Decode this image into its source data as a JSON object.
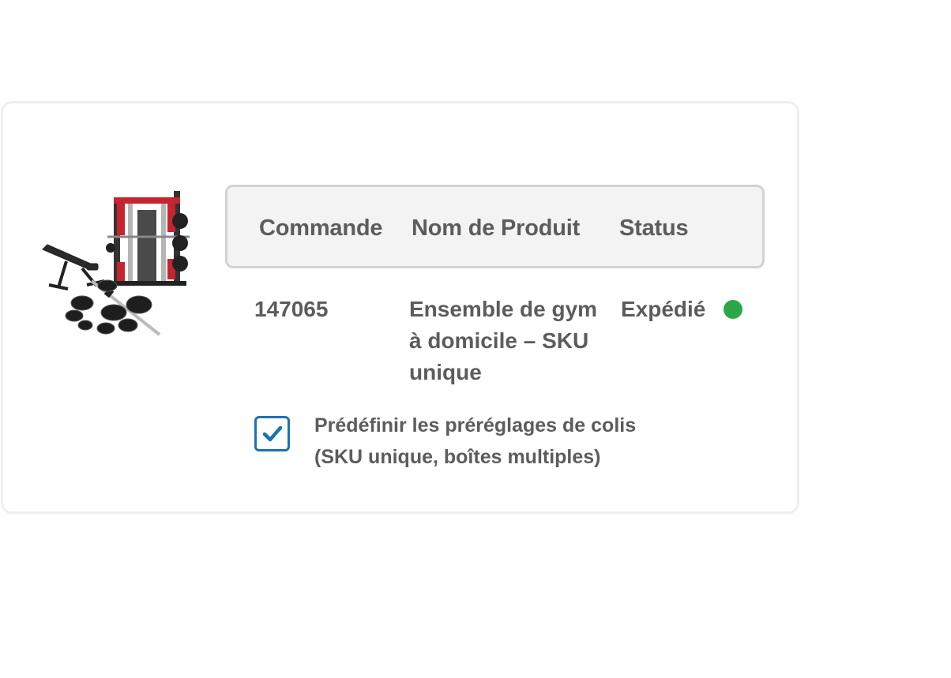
{
  "table": {
    "headers": {
      "order": "Commande",
      "product_name": "Nom de Produit",
      "status": "Status"
    },
    "rows": [
      {
        "order": "147065",
        "product_name": "Ensemble de gym à domicile – SKU unique",
        "status": "Expédié",
        "status_color": "#2aa847"
      }
    ]
  },
  "preset_option": {
    "checked": true,
    "label_line1": "Prédéfinir les préréglages de colis",
    "label_line2": "(SKU unique, boîtes multiples)"
  },
  "colors": {
    "accent": "#1d72b0",
    "header_bg": "#f3f3f3",
    "text": "#5c5c5c",
    "gym_red": "#c8242f"
  },
  "icons": {
    "product": "home-gym-equipment-image",
    "status": "status-dot",
    "checkbox": "checkmark-icon"
  }
}
